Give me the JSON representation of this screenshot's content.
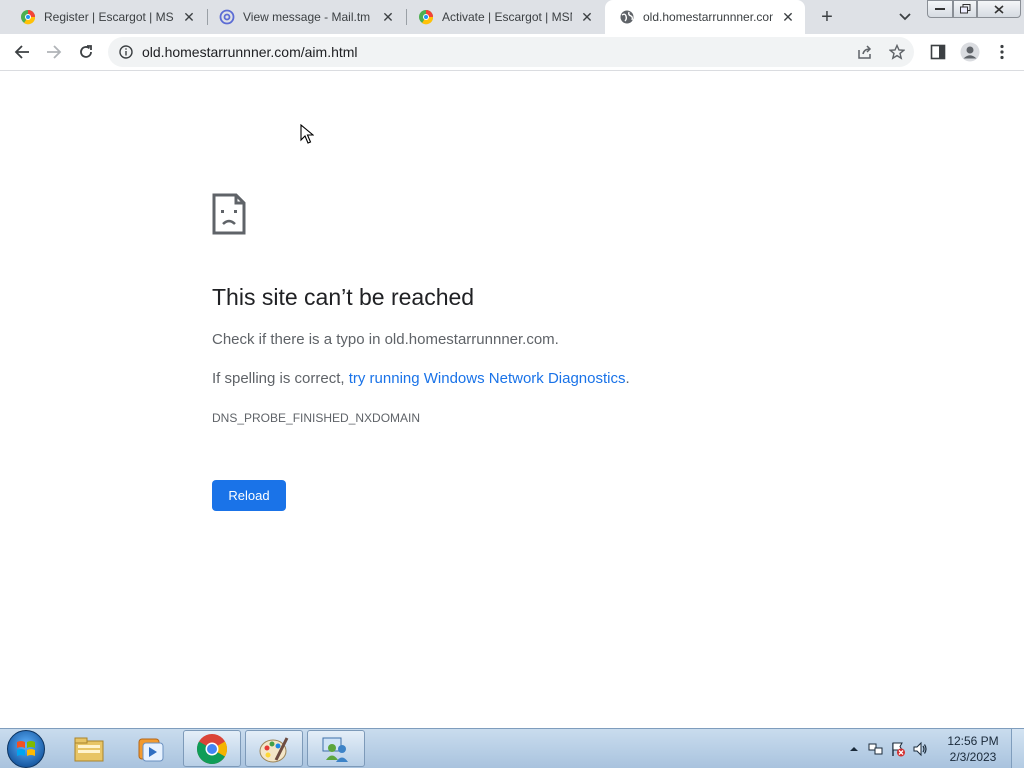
{
  "browser": {
    "tabs": [
      {
        "title": "Register | Escargot | MSN",
        "favicon": "escargot-icon",
        "active": false
      },
      {
        "title": "View message - Mail.tm",
        "favicon": "at-sign-icon",
        "active": false
      },
      {
        "title": "Activate | Escargot | MSN",
        "favicon": "escargot-icon",
        "active": false
      },
      {
        "title": "old.homestarrunnner.com",
        "favicon": "globe-icon",
        "active": true
      }
    ],
    "new_tab_label": "+",
    "url": "old.homestarrunnner.com/aim.html"
  },
  "error_page": {
    "title": "This site can’t be reached",
    "line1": "Check if there is a typo in old.homestarrunnner.com.",
    "line2_prefix": "If spelling is correct, ",
    "line2_link": "try running Windows Network Diagnostics",
    "line2_suffix": ".",
    "error_code": "DNS_PROBE_FINISHED_NXDOMAIN",
    "reload_label": "Reload"
  },
  "taskbar": {
    "apps": [
      "explorer-icon",
      "media-player-icon",
      "chrome-icon",
      "paint-icon",
      "network-people-icon"
    ],
    "clock_time": "12:56 PM",
    "clock_date": "2/3/2023"
  },
  "colors": {
    "accent": "#1a73e8",
    "tabstrip_bg": "#dee1e6"
  }
}
